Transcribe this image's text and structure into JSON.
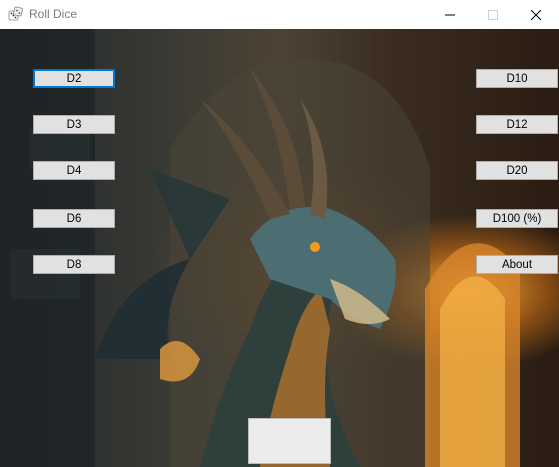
{
  "window": {
    "title": "Roll Dice",
    "app_icon": "dice-icon",
    "controls": [
      "minimize-icon",
      "maximize-icon",
      "close-icon"
    ]
  },
  "left_buttons": [
    {
      "label": "D2",
      "focused": true
    },
    {
      "label": "D3"
    },
    {
      "label": "D4"
    },
    {
      "label": "D6"
    },
    {
      "label": "D8"
    }
  ],
  "right_buttons": [
    {
      "label": "D10"
    },
    {
      "label": "D12"
    },
    {
      "label": "D20"
    },
    {
      "label": "D100 (%)"
    },
    {
      "label": "About"
    }
  ],
  "result": {
    "value": ""
  },
  "background": {
    "image": "dragon-artwork",
    "accent": "#f0a030"
  },
  "colors": {
    "focus_border": "#0078d7",
    "button_face": "#e1e1e1"
  }
}
